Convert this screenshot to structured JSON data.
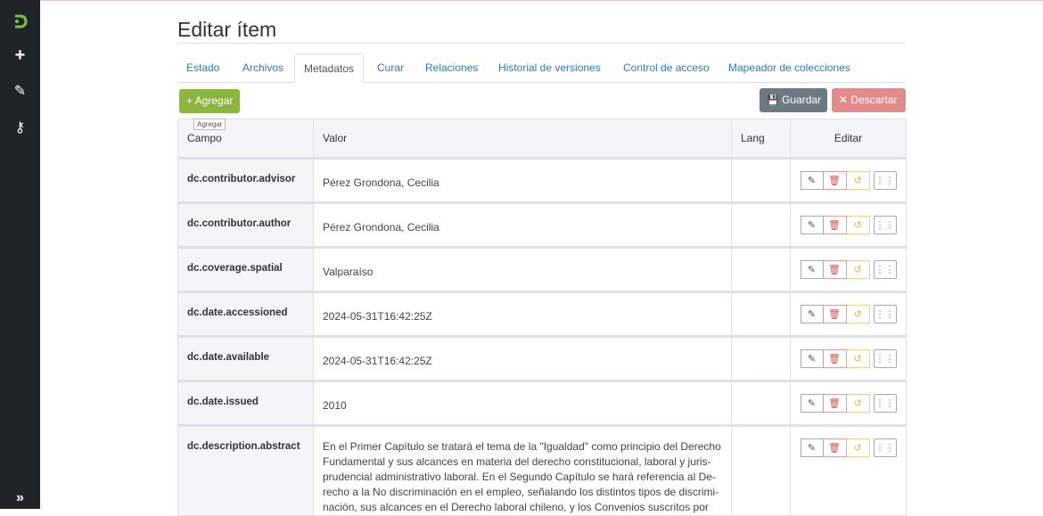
{
  "sidebar": {
    "logo": "logo-icon",
    "items": [
      {
        "name": "plus-icon",
        "glyph": "+"
      },
      {
        "name": "pencil-icon",
        "glyph": "✎"
      },
      {
        "name": "key-icon",
        "glyph": "⚷"
      }
    ],
    "expand_glyph": "»"
  },
  "page": {
    "title": "Editar ítem"
  },
  "tabs": [
    {
      "label": "Estado",
      "active": false
    },
    {
      "label": "Archivos",
      "active": false
    },
    {
      "label": "Metadatos",
      "active": true
    },
    {
      "label": "Curar",
      "active": false
    },
    {
      "label": "Relaciones",
      "active": false
    },
    {
      "label": "Historial de versiones",
      "active": false
    },
    {
      "label": "Control de acceso",
      "active": false
    },
    {
      "label": "Mapeador de colecciones",
      "active": false
    }
  ],
  "toolbar": {
    "add_label": "+ Agregar",
    "add_tooltip": "Agregar",
    "save_label": "Guardar",
    "discard_label": "Descartar"
  },
  "table": {
    "headers": {
      "field": "Campo",
      "value": "Valor",
      "lang": "Lang",
      "edit": "Editar"
    },
    "rows": [
      {
        "field": "dc.contributor.advisor",
        "value": "Pérez Grondona, Cecilia",
        "lang": ""
      },
      {
        "field": "dc.contributor.author",
        "value": "Pérez Grondona, Cecilia",
        "lang": ""
      },
      {
        "field": "dc.coverage.spatial",
        "value": "Valparaíso",
        "lang": ""
      },
      {
        "field": "dc.date.accessioned",
        "value": "2024-05-31T16:42:25Z",
        "lang": ""
      },
      {
        "field": "dc.date.available",
        "value": "2024-05-31T16:42:25Z",
        "lang": ""
      },
      {
        "field": "dc.date.issued",
        "value": "2010",
        "lang": ""
      },
      {
        "field": "dc.description.abstract",
        "value": "En el Primer Capítulo se tratará el tema de la \"Igualdad\" como principio del Derecho Fundamental y sus alcances en materia del derecho constitucional, laboral y juris-prudencial administrativo laboral. En el Segundo Capítulo se hará referencia al De-recho a la No discriminación en el empleo, señalando los distintos tipos de discrimi-nación, sus alcances en el Derecho laboral chileno, y los Convenios suscritos por",
        "lang": ""
      }
    ]
  },
  "colors": {
    "sidebar_bg": "#1f2428",
    "add_button": "#8ab53e",
    "save_button": "#6d7a83",
    "discard_button": "#e38a8a",
    "tab_link": "#2b7bbf",
    "logo_green": "#7ac143"
  }
}
